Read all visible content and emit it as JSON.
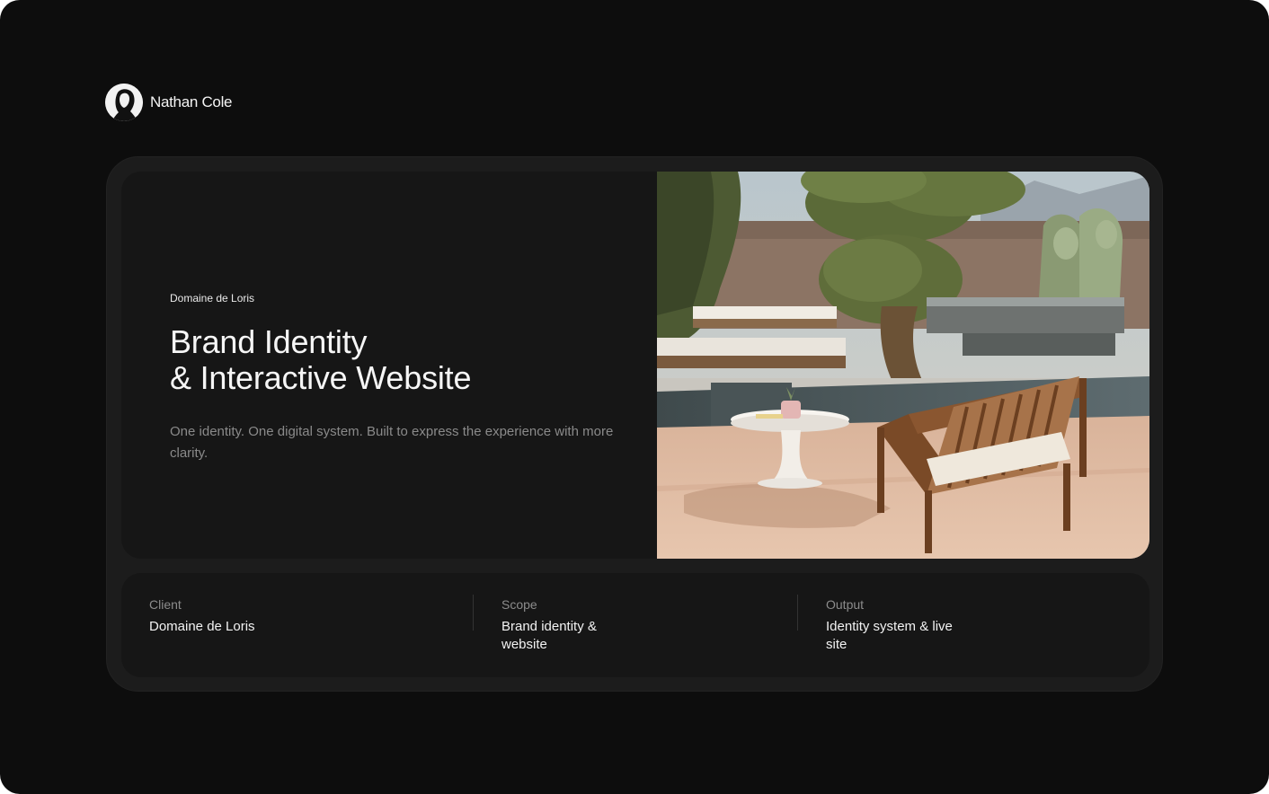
{
  "header": {
    "author_name": "Nathan Cole",
    "avatar_icon": "person-silhouette-icon"
  },
  "hero": {
    "eyebrow": "Domaine de Loris",
    "title_line1": "Brand Identity",
    "title_line2": "& Interactive Website",
    "description": "One identity. One digital system. Built to express the experience with more clarity.",
    "image_alt": "Outdoor patio with wooden lounge chair, round white side table, reflecting pools and sculpted trees"
  },
  "meta": {
    "client": {
      "label": "Client",
      "value": "Domaine de Loris"
    },
    "scope": {
      "label": "Scope",
      "value_line1": "Brand identity &",
      "value_line2": "website"
    },
    "output": {
      "label": "Output",
      "value_line1": "Identity system & live",
      "value_line2": "site"
    }
  },
  "colors": {
    "background": "#0d0d0d",
    "card": "#1c1c1c",
    "panel": "#161616",
    "text_primary": "#f4f4f4",
    "text_muted": "#8a8a8a"
  }
}
